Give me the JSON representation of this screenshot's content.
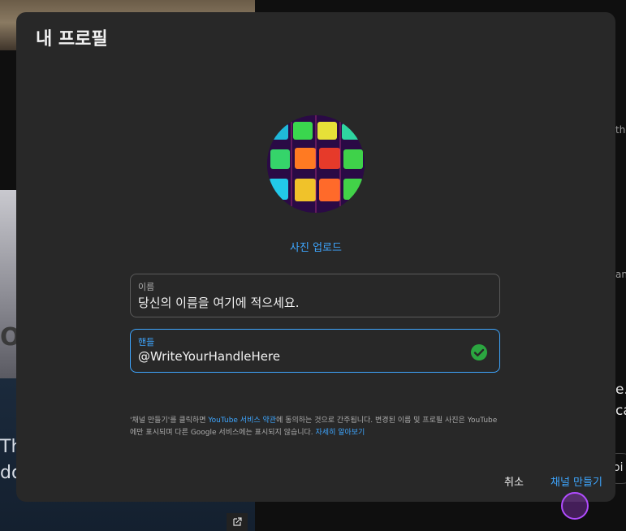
{
  "background": {
    "left_texts": [
      "OL",
      "Th",
      "do"
    ],
    "right_texts": [
      "the",
      "and",
      "e.",
      "ca",
      "oi"
    ]
  },
  "dialog": {
    "title": "내 프로필",
    "upload_label": "사진 업로드",
    "name_field": {
      "label": "이름",
      "value": "당신의 이름을 여기에 적으세요."
    },
    "handle_field": {
      "label": "핸들",
      "value": "@WriteYourHandleHere",
      "status": "check-circle-icon",
      "status_color": "#2ba640"
    },
    "terms": {
      "part1": "'채널 만들기'를 클릭하면 ",
      "link1": "YouTube 서비스 약관",
      "part2": "에 동의하는 것으로 간주됩니다. 변경된 이름 및 프로필 사진은 YouTube에만 표시되며 다른 Google 서비스에는 표시되지 않습니다. ",
      "link2": "자세히 알아보기"
    },
    "cancel_label": "취소",
    "create_label": "채널 만들기"
  },
  "colors": {
    "accent": "#3ea6ff",
    "dialog_bg": "#282828",
    "page_bg": "#0f0f0f"
  }
}
